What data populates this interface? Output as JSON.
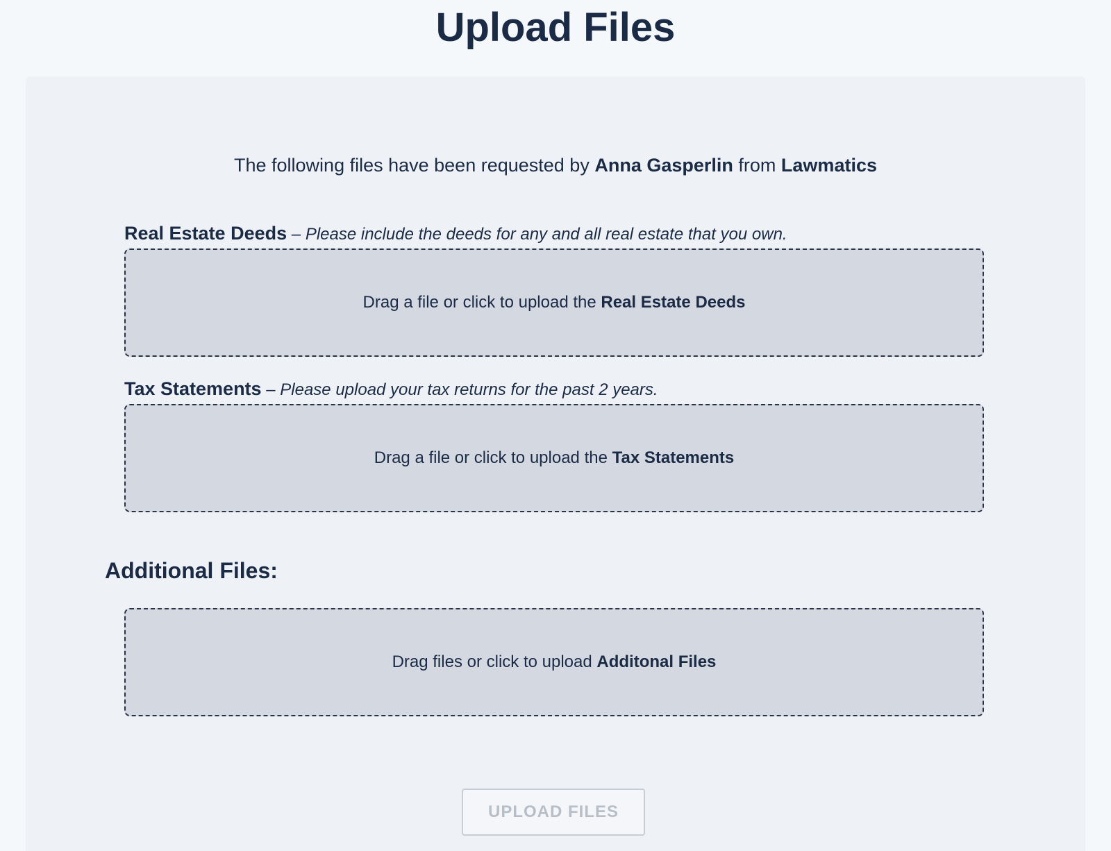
{
  "header": {
    "title": "Upload Files"
  },
  "request": {
    "prefix": "The following files have been requested by",
    "requester": "Anna Gasperlin",
    "connector": "from",
    "organization": "Lawmatics"
  },
  "requested_files": [
    {
      "name": "Real Estate Deeds",
      "separator": " – ",
      "description": "Please include the deeds for any and all real estate that you own.",
      "drop_prefix": "Drag a file or click to upload the",
      "drop_target": "Real Estate Deeds"
    },
    {
      "name": "Tax Statements",
      "separator": " – ",
      "description": "Please upload your tax returns for the past 2 years.",
      "drop_prefix": "Drag a file or click to upload the",
      "drop_target": "Tax Statements"
    }
  ],
  "additional": {
    "heading": "Additional Files:",
    "drop_prefix": "Drag files or click to upload",
    "drop_target": "Additonal Files"
  },
  "actions": {
    "upload_label": "UPLOAD FILES",
    "upload_disabled": true
  },
  "colors": {
    "page_background": "#f4f8fb",
    "panel_background": "#eef2f6",
    "dropzone_background": "#d4d9e1",
    "text_primary": "#1b2b45",
    "button_disabled_text": "#b8bec8"
  }
}
